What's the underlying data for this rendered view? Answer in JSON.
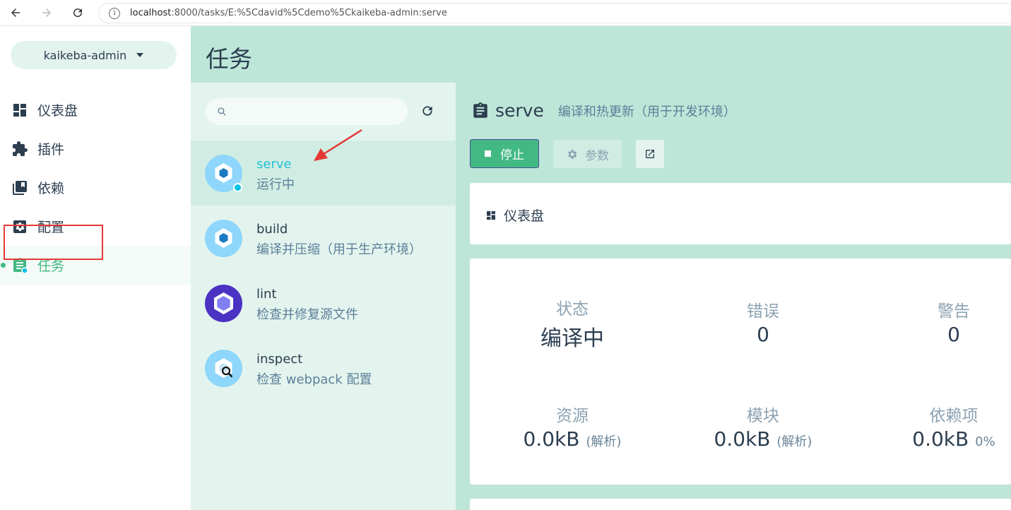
{
  "browser": {
    "url_host": "localhost",
    "url_path": ":8000/tasks/E:%5Cdavid%5Cdemo%5Ckaikeba-admin:serve"
  },
  "sidebar": {
    "project": "kaikeba-admin",
    "items": [
      {
        "label": "仪表盘",
        "icon": "dashboard-icon"
      },
      {
        "label": "插件",
        "icon": "puzzle-icon"
      },
      {
        "label": "依赖",
        "icon": "library-icon"
      },
      {
        "label": "配置",
        "icon": "settings-box-icon"
      },
      {
        "label": "任务",
        "icon": "clipboard-icon",
        "active": true
      }
    ]
  },
  "header": {
    "title": "任务"
  },
  "task_list": {
    "search_placeholder": "",
    "tasks": [
      {
        "name": "serve",
        "desc": "运行中",
        "icon": "webpack-icon",
        "running": true
      },
      {
        "name": "build",
        "desc": "编译并压缩（用于生产环境）",
        "icon": "webpack-icon"
      },
      {
        "name": "lint",
        "desc": "检查并修复源文件",
        "icon": "eslint-icon"
      },
      {
        "name": "inspect",
        "desc": "检查 webpack 配置",
        "icon": "webpack-inspect-icon"
      }
    ]
  },
  "detail": {
    "name": "serve",
    "desc": "编译和热更新（用于开发环境）",
    "stop_label": "停止",
    "params_label": "参数",
    "dashboard_label": "仪表盘",
    "stats": {
      "status_label": "状态",
      "status_value": "编译中",
      "errors_label": "错误",
      "errors_value": "0",
      "warnings_label": "警告",
      "warnings_value": "0",
      "assets_label": "资源",
      "assets_value": "0.0kB",
      "assets_note": "(解析)",
      "modules_label": "模块",
      "modules_value": "0.0kB",
      "modules_note": "(解析)",
      "deps_label": "依赖项",
      "deps_value": "0.0kB",
      "deps_note": "0%"
    }
  },
  "colors": {
    "accent": "#42b983",
    "header_bg": "#bde6d8",
    "panel_bg": "#e3f4ee",
    "running": "#03c2e6"
  }
}
